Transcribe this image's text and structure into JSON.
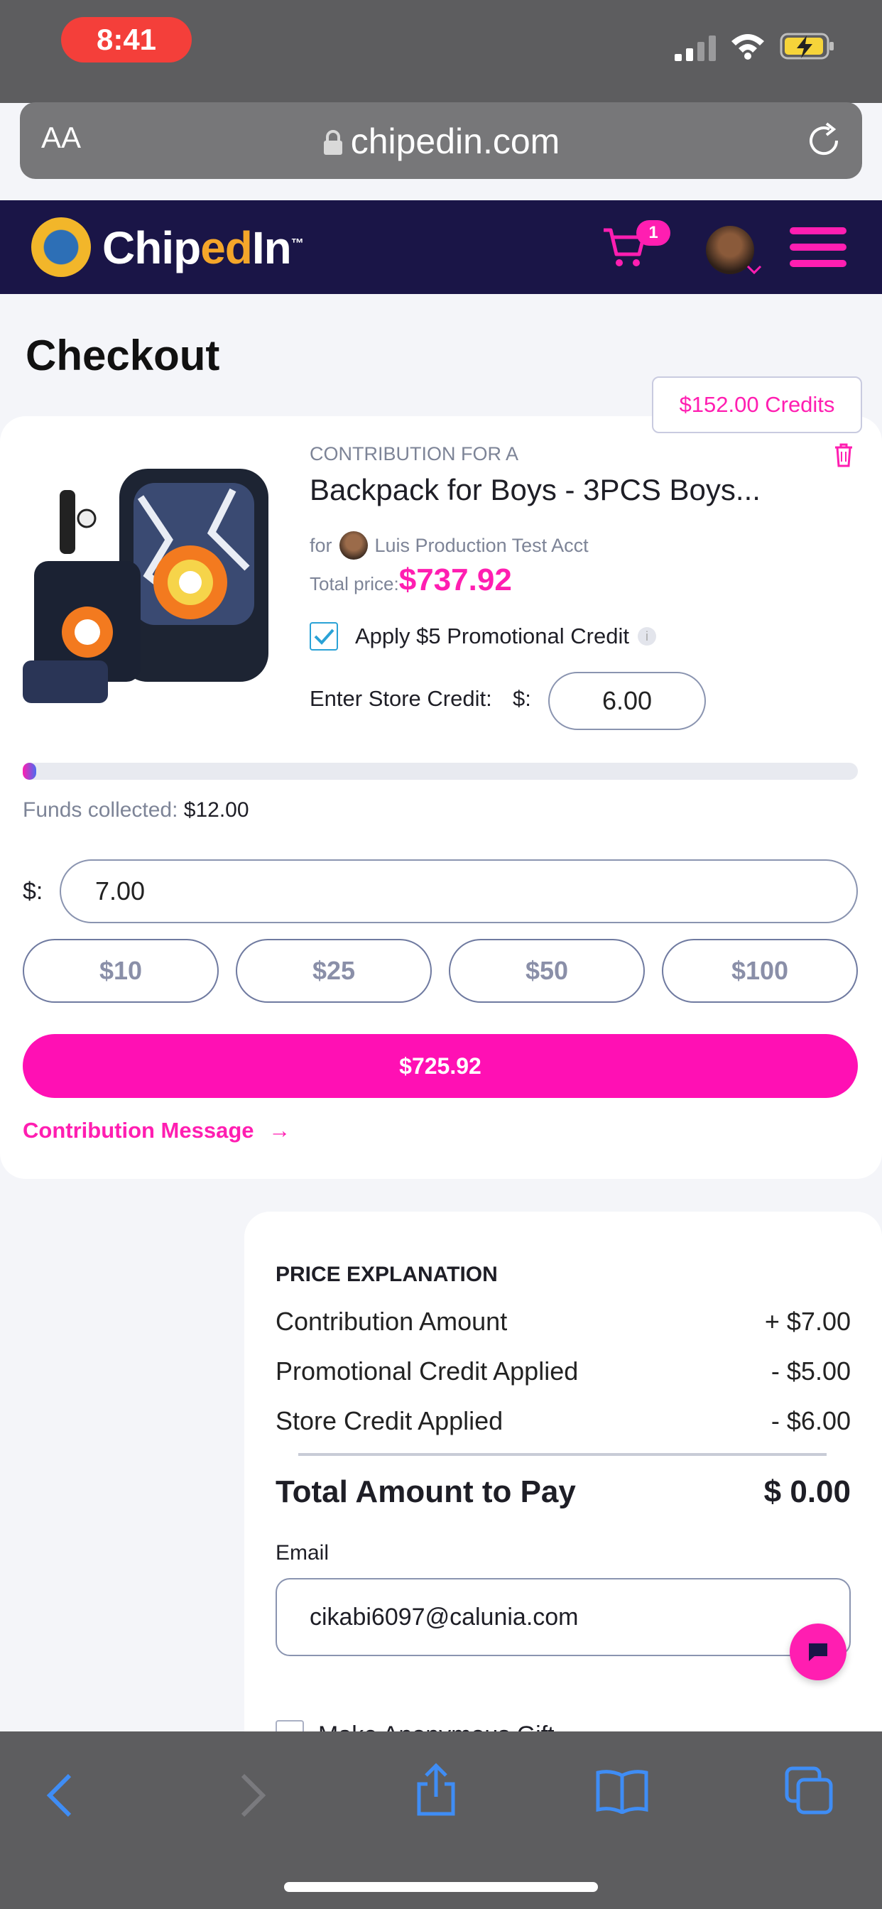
{
  "status_bar": {
    "time": "8:41"
  },
  "browser": {
    "aa_label": "AA",
    "url": "chipedin.com"
  },
  "navbar": {
    "logo_prefix": "Chip",
    "logo_mid": "ed",
    "logo_suffix": "In",
    "logo_tm": "™",
    "cart_count": "1"
  },
  "page": {
    "title": "Checkout",
    "credits_button": "$152.00 Credits"
  },
  "item": {
    "overline": "CONTRIBUTION FOR A",
    "name": "Backpack for Boys - 3PCS Boys...",
    "for_label": "for",
    "recipient": "Luis Production Test Acct",
    "total_price_label": "Total price:",
    "total_price": "$737.92",
    "promo_label": "Apply $5 Promotional Credit",
    "promo_checked": true,
    "store_credit_label": "Enter Store Credit:",
    "currency_label": "$:",
    "store_credit_value": "6.00"
  },
  "progress": {
    "fraction": 0.016,
    "funds_label": "Funds collected:",
    "funds_value": "$12.00"
  },
  "contribution": {
    "currency_label": "$:",
    "amount_value": "7.00",
    "quick_amounts": [
      "$10",
      "$25",
      "$50",
      "$100"
    ],
    "pay_button": "$725.92",
    "message_link": "Contribution Message",
    "message_arrow": "→"
  },
  "price_explanation": {
    "heading": "PRICE EXPLANATION",
    "rows": [
      {
        "label": "Contribution Amount",
        "value": "+ $7.00"
      },
      {
        "label": "Promotional Credit Applied",
        "value": "- $5.00"
      },
      {
        "label": "Store Credit Applied",
        "value": "- $6.00"
      }
    ],
    "total_label": "Total Amount to Pay",
    "total_value": "$ 0.00",
    "email_label": "Email",
    "email_value": "cikabi6097@calunia.com",
    "partial_checkbox_label": "Make Anonymous Gift"
  },
  "colors": {
    "accent": "#ff10b4",
    "navbar": "#1a1547",
    "promo_check": "#2aa2d6"
  }
}
